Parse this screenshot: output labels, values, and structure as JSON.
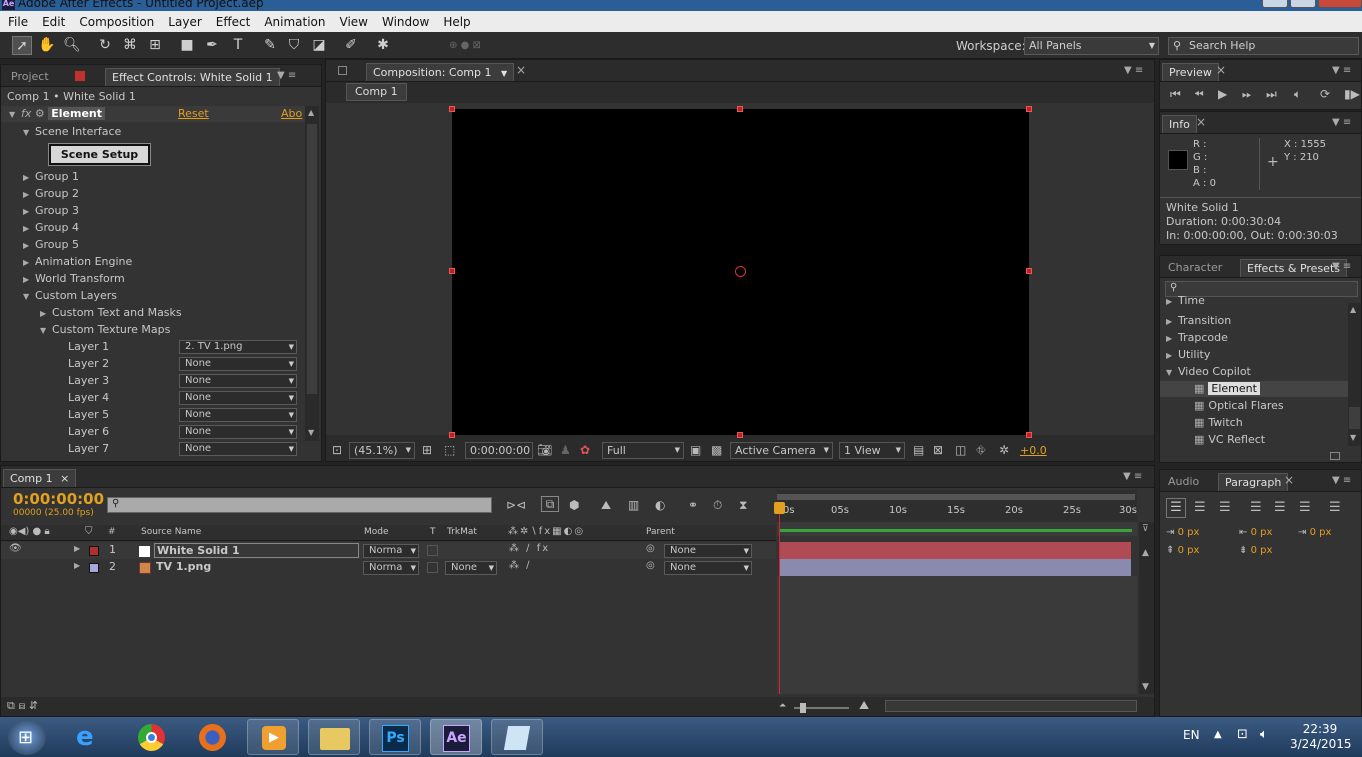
{
  "window": {
    "title": "Adobe After Effects - Untitled Project.aep",
    "app_badge": "Ae"
  },
  "menu": [
    "File",
    "Edit",
    "Composition",
    "Layer",
    "Effect",
    "Animation",
    "View",
    "Window",
    "Help"
  ],
  "toolbar": {
    "workspace_label": "Workspace:",
    "workspace_value": "All Panels",
    "search_placeholder": "Search Help"
  },
  "left_panel": {
    "tab_project": "Project",
    "tab_effect_controls": "Effect Controls: White Solid 1",
    "breadcrumb": "Comp 1 • White Solid 1",
    "effect_name": "Element",
    "reset": "Reset",
    "about": "Abo",
    "scene_interface": "Scene Interface",
    "scene_setup": "Scene Setup",
    "groups": [
      "Group 1",
      "Group 2",
      "Group 3",
      "Group 4",
      "Group 5",
      "Animation Engine",
      "World Transform"
    ],
    "custom_layers": "Custom Layers",
    "custom_text_masks": "Custom Text and Masks",
    "custom_texture_maps": "Custom Texture Maps",
    "layers": [
      {
        "label": "Layer 1",
        "value": "2. TV 1.png"
      },
      {
        "label": "Layer 2",
        "value": "None"
      },
      {
        "label": "Layer 3",
        "value": "None"
      },
      {
        "label": "Layer 4",
        "value": "None"
      },
      {
        "label": "Layer 5",
        "value": "None"
      },
      {
        "label": "Layer 6",
        "value": "None"
      },
      {
        "label": "Layer 7",
        "value": "None"
      }
    ]
  },
  "comp_panel": {
    "tab": "Composition: Comp 1",
    "sub_tab": "Comp 1",
    "zoom": "(45.1%)",
    "timecode": "0:00:00:00",
    "resolution": "Full",
    "camera": "Active Camera",
    "view": "1 View",
    "exposure": "+0.0"
  },
  "preview": {
    "tab": "Preview"
  },
  "info": {
    "tab": "Info",
    "r": "R :",
    "g": "G :",
    "b": "B :",
    "a": "A : 0",
    "x": "X : 1555",
    "y": "Y : 210",
    "layer": "White Solid 1",
    "duration": "Duration: 0:00:30:04",
    "inout": "In: 0:00:00:00, Out: 0:00:30:03"
  },
  "effects": {
    "tab_character": "Character",
    "tab_effects": "Effects & Presets",
    "top_partial": "Time",
    "categories": [
      "Transition",
      "Trapcode",
      "Utility",
      "Video Copilot"
    ],
    "items": [
      "Element",
      "Optical Flares",
      "Twitch",
      "VC Reflect"
    ]
  },
  "paragraph": {
    "tab_audio": "Audio",
    "tab_paragraph": "Paragraph",
    "px": "0 px"
  },
  "timeline": {
    "tab": "Comp 1",
    "timecode": "0:00:00:00",
    "frames": "00000 (25.00 fps)",
    "headers": {
      "source": "Source Name",
      "mode": "Mode",
      "t": "T",
      "trkmat": "TrkMat",
      "parent": "Parent"
    },
    "ruler": [
      "0s",
      "05s",
      "10s",
      "15s",
      "20s",
      "25s",
      "30s"
    ],
    "layers": [
      {
        "num": "1",
        "name": "White Solid 1",
        "mode": "Norma",
        "trkmat": "",
        "parent": "None",
        "label_color": "#b03030",
        "bar_color": "#b04a55"
      },
      {
        "num": "2",
        "name": "TV 1.png",
        "mode": "Norma",
        "trkmat": "None",
        "parent": "None",
        "label_color": "#a8a8d8",
        "bar_color": "#8a8aae"
      }
    ]
  },
  "taskbar": {
    "lang": "EN",
    "time": "22:39",
    "date": "3/24/2015",
    "ps": "Ps",
    "ae": "Ae"
  }
}
